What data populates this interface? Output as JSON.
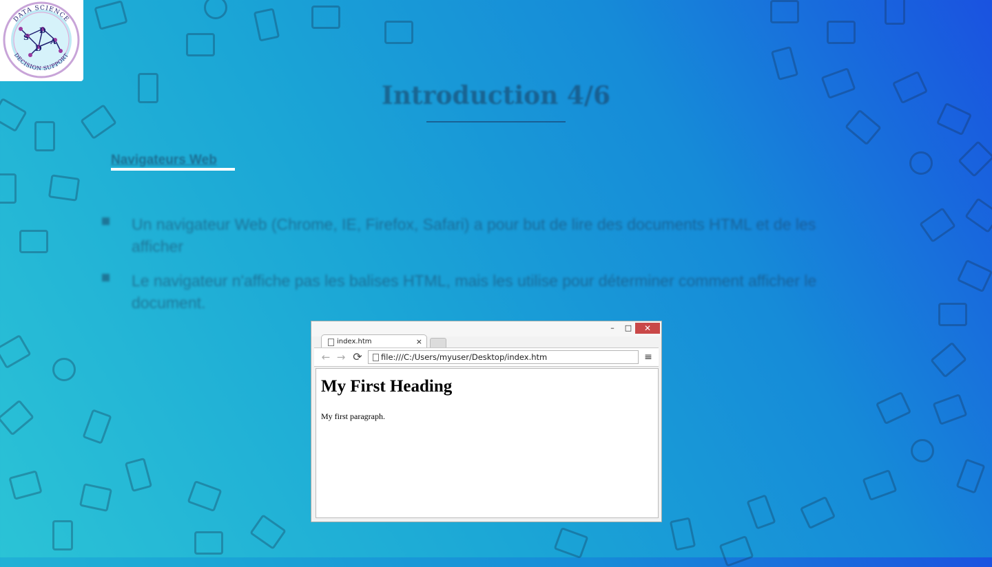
{
  "slide": {
    "title": "Introduction 4/6",
    "subtitle": "Navigateurs Web",
    "bullets": [
      "Un navigateur Web (Chrome, IE, Firefox, Safari) a pour but de lire des documents HTML et de les afficher",
      "Le navigateur n'affiche pas les balises HTML, mais les utilise pour déterminer comment afficher le document."
    ]
  },
  "logo": {
    "top_text": "DATA SCIENCE",
    "bottom_text": "DECISION SUPPORT",
    "letters": [
      "S",
      "D",
      "A",
      "D"
    ]
  },
  "browser": {
    "tab_title": "index.htm",
    "tab_close": "×",
    "window_controls": {
      "minimize": "–",
      "maximize": "□",
      "close": "✕"
    },
    "nav": {
      "back": "←",
      "forward": "→",
      "reload": "⟳",
      "menu": "≡"
    },
    "address": "file:///C:/Users/myuser/Desktop/index.htm",
    "page": {
      "heading": "My First Heading",
      "paragraph": "My first paragraph."
    }
  },
  "colors": {
    "background_start": "#2bc3d6",
    "background_end": "#1a52e0",
    "close_button": "#c94848"
  }
}
